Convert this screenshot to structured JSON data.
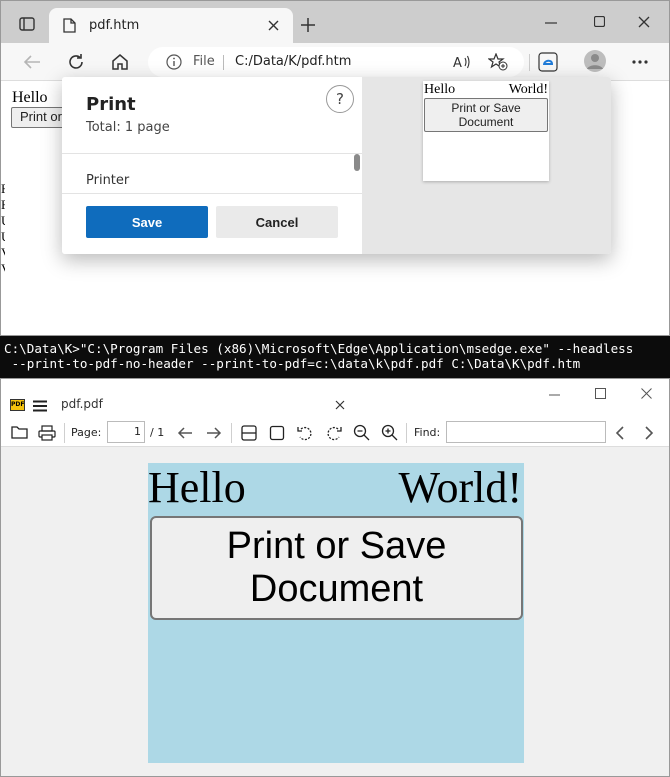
{
  "browser": {
    "tab_title": "pdf.htm",
    "address": {
      "scheme_label": "File",
      "url": "C:/Data/K/pdf.htm"
    },
    "page": {
      "text": "Hello",
      "button_label": "Print or"
    },
    "left_edge_marks": [
      "F",
      "F",
      "U",
      "U",
      "V",
      "V"
    ]
  },
  "print_dialog": {
    "title": "Print",
    "total": "Total: 1 page",
    "help_label": "?",
    "printer_label": "Printer",
    "save_label": "Save",
    "cancel_label": "Cancel",
    "preview": {
      "hello": "Hello",
      "world": "World!",
      "button_label": "Print or Save Document"
    }
  },
  "console": {
    "line1": "C:\\Data\\K>\"C:\\Program Files (x86)\\Microsoft\\Edge\\Application\\msedge.exe\" --headless",
    "line2": " --print-to-pdf-no-header --print-to-pdf=c:\\data\\k\\pdf.pdf C:\\Data\\K\\pdf.htm"
  },
  "pdf_viewer": {
    "title": "pdf.pdf",
    "app_icon_text": "PDF",
    "page_label": "Page:",
    "page_value": "1",
    "page_total": "/ 1",
    "find_label": "Find:",
    "document": {
      "hello": "Hello",
      "world": "World!",
      "button_label_line1": "Print or Save",
      "button_label_line2": "Document"
    }
  },
  "colors": {
    "accent": "#0f6cbd",
    "pdf_page_bg": "#add8e6",
    "console_bg": "#0c0c0c"
  }
}
